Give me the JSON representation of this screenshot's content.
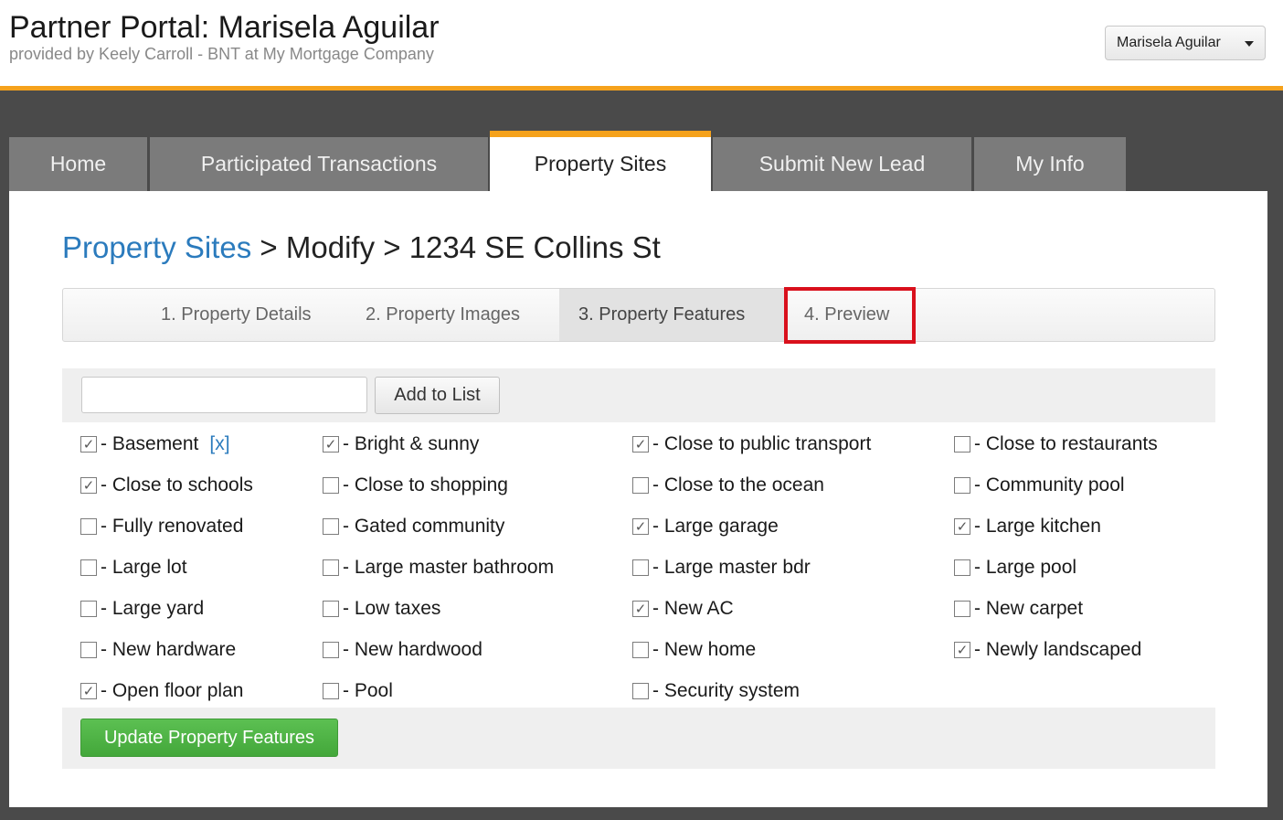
{
  "header": {
    "title": "Partner Portal: Marisela Aguilar",
    "subtitle": "provided by Keely Carroll - BNT at My Mortgage Company",
    "user_menu": "Marisela Aguilar"
  },
  "nav": {
    "tabs": [
      {
        "label": "Home"
      },
      {
        "label": "Participated Transactions"
      },
      {
        "label": "Property Sites",
        "active": true
      },
      {
        "label": "Submit New Lead"
      },
      {
        "label": "My Info"
      }
    ]
  },
  "breadcrumb": {
    "link": "Property Sites",
    "separator": ">",
    "current": "Modify",
    "address": "1234 SE Collins St"
  },
  "steps": [
    {
      "label": "1. Property Details"
    },
    {
      "label": "2. Property Images"
    },
    {
      "label": "3. Property Features",
      "active": true
    },
    {
      "label": "4. Preview"
    }
  ],
  "add_feature": {
    "input_value": "",
    "button_label": "Add to List"
  },
  "features": [
    {
      "label": "- Basement",
      "checked": true,
      "remove": "[x]"
    },
    {
      "label": "- Bright & sunny",
      "checked": true
    },
    {
      "label": "- Close to public transport",
      "checked": true
    },
    {
      "label": "- Close to restaurants",
      "checked": false
    },
    {
      "label": "- Close to schools",
      "checked": true
    },
    {
      "label": "- Close to shopping",
      "checked": false
    },
    {
      "label": "- Close to the ocean",
      "checked": false
    },
    {
      "label": "- Community pool",
      "checked": false
    },
    {
      "label": "- Fully renovated",
      "checked": false
    },
    {
      "label": "- Gated community",
      "checked": false
    },
    {
      "label": "- Large garage",
      "checked": true
    },
    {
      "label": "- Large kitchen",
      "checked": true
    },
    {
      "label": "- Large lot",
      "checked": false
    },
    {
      "label": "- Large master bathroom",
      "checked": false
    },
    {
      "label": "- Large master bdr",
      "checked": false
    },
    {
      "label": "- Large pool",
      "checked": false
    },
    {
      "label": "- Large yard",
      "checked": false
    },
    {
      "label": "- Low taxes",
      "checked": false
    },
    {
      "label": "- New AC",
      "checked": true
    },
    {
      "label": "- New carpet",
      "checked": false
    },
    {
      "label": "- New hardware",
      "checked": false
    },
    {
      "label": "- New hardwood",
      "checked": false
    },
    {
      "label": "- New home",
      "checked": false
    },
    {
      "label": "- Newly landscaped",
      "checked": true
    },
    {
      "label": "- Open floor plan",
      "checked": true
    },
    {
      "label": "- Pool",
      "checked": false
    },
    {
      "label": "- Security system",
      "checked": false
    }
  ],
  "update_button": "Update Property Features",
  "colors": {
    "accent_orange": "#f5a21c",
    "link_blue": "#2b7bbd",
    "highlight_red": "#d9101c",
    "button_green": "#4cb144",
    "tab_gray": "#7b7b7b"
  }
}
